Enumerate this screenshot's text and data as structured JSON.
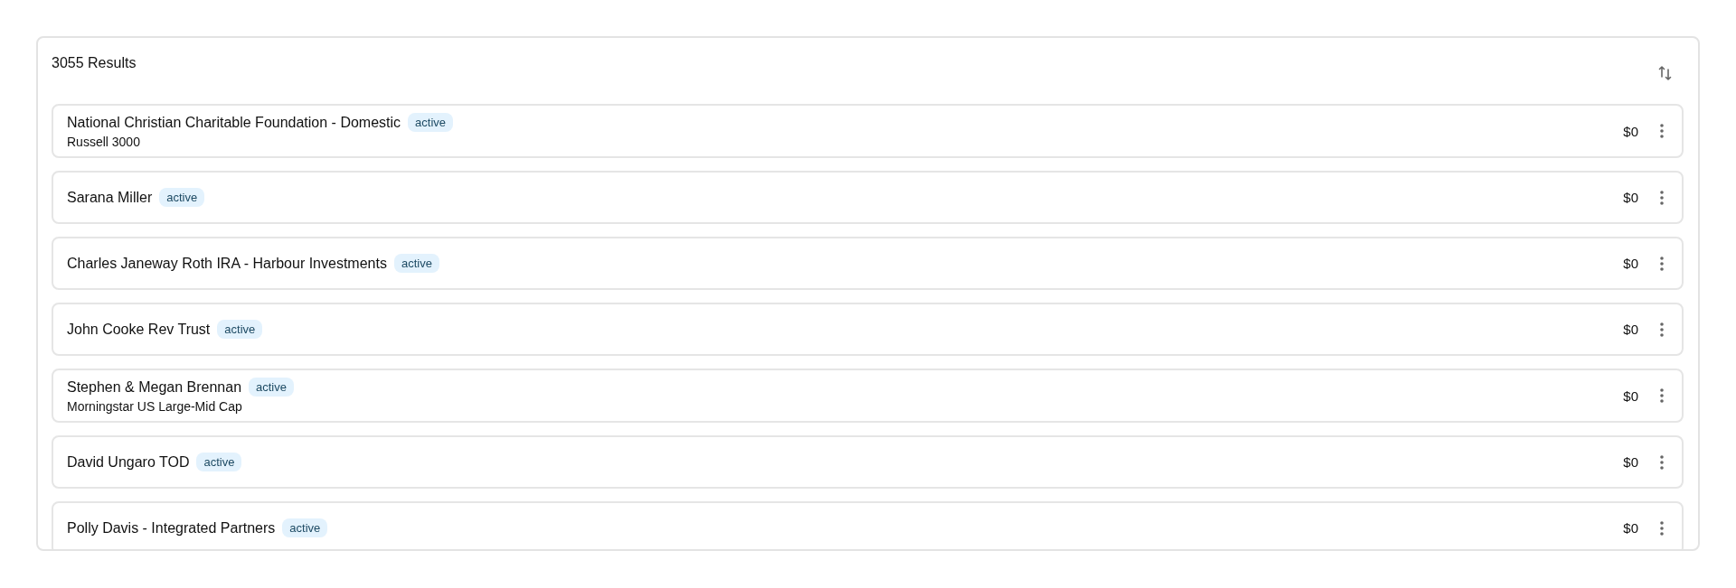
{
  "results_count": "3055 Results",
  "rows": [
    {
      "name": "National Christian Charitable Foundation - Domestic",
      "status": "active",
      "subtitle": "Russell 3000",
      "amount": "$0"
    },
    {
      "name": "Sarana Miller",
      "status": "active",
      "amount": "$0"
    },
    {
      "name": "Charles Janeway Roth IRA - Harbour Investments",
      "status": "active",
      "amount": "$0"
    },
    {
      "name": "John Cooke Rev Trust",
      "status": "active",
      "amount": "$0"
    },
    {
      "name": "Stephen & Megan Brennan",
      "status": "active",
      "subtitle": "Morningstar US Large-Mid Cap",
      "amount": "$0"
    },
    {
      "name": "David Ungaro TOD",
      "status": "active",
      "amount": "$0"
    },
    {
      "name": "Polly Davis - Integrated Partners",
      "status": "active",
      "amount": "$0"
    }
  ]
}
